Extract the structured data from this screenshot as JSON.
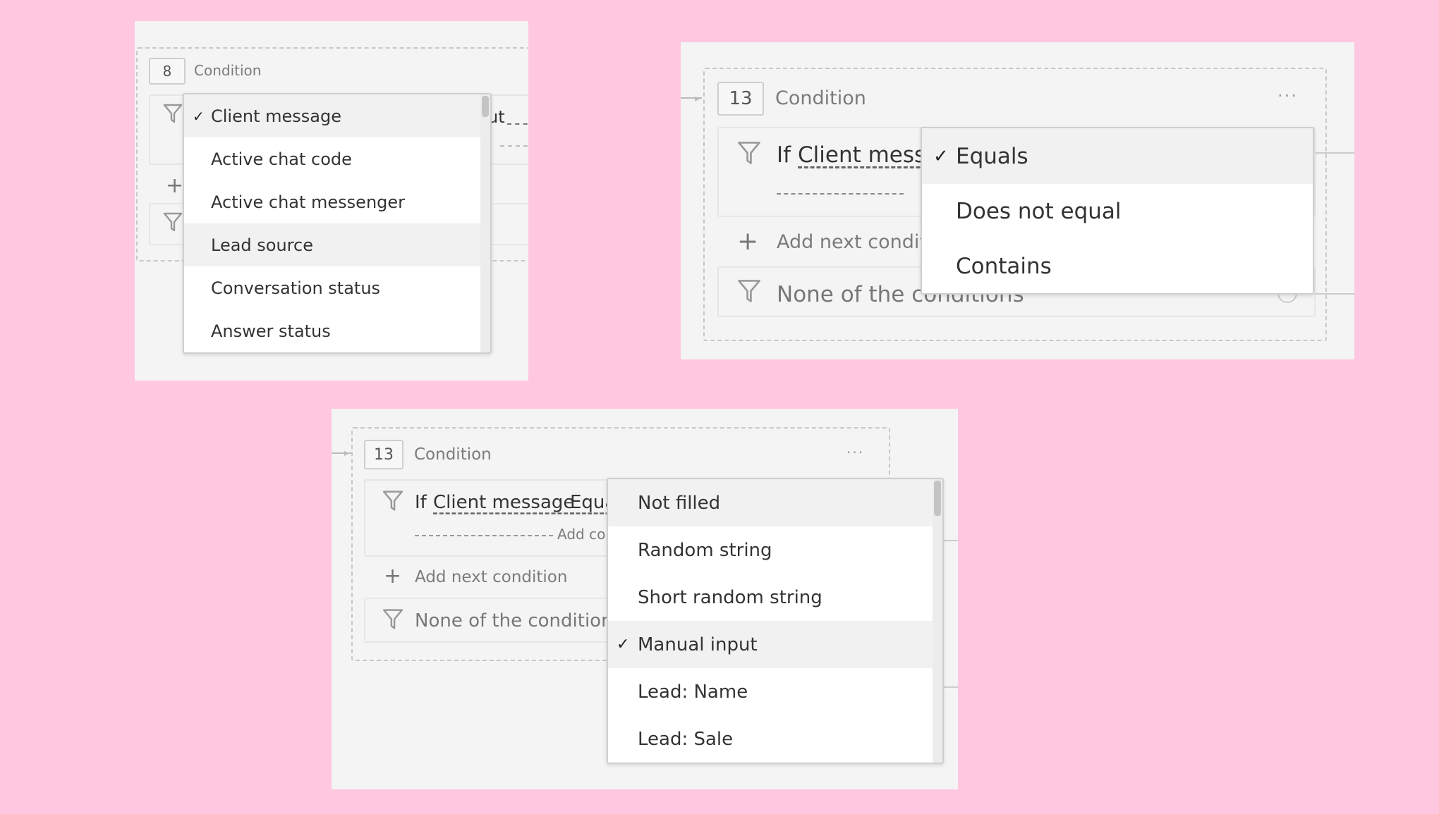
{
  "background_color": "#ffc8e0",
  "panel1": {
    "badge": "8",
    "title": "Condition",
    "peek_text": "ut",
    "icons": [
      "funnel-icon",
      "plus-icon"
    ],
    "dropdown": {
      "selected": "Client message",
      "highlighted": "Lead source",
      "options": [
        "Client message",
        "Active chat code",
        "Active chat messenger",
        "Lead source",
        "Conversation status",
        "Answer status"
      ]
    }
  },
  "panel2": {
    "badge": "13",
    "title": "Condition",
    "more": "···",
    "if_prefix": "If",
    "if_field": "Client messa",
    "add_next": "Add next conditi",
    "none_conditions": "None of the conditions",
    "dropdown": {
      "selected": "Equals",
      "options": [
        "Equals",
        "Does not equal",
        "Contains"
      ]
    }
  },
  "panel3": {
    "badge": "13",
    "title": "Condition",
    "more": "···",
    "if_prefix": "If",
    "if_field": "Client message",
    "if_operator": "Equa",
    "add_co": "Add co",
    "add_next": "Add next condition",
    "none_conditions": "None of the conditions",
    "dropdown": {
      "selected": "Manual input",
      "highlighted": "Not filled",
      "options": [
        "Not filled",
        "Random string",
        "Short random string",
        "Manual input",
        "Lead: Name",
        "Lead: Sale"
      ]
    }
  }
}
